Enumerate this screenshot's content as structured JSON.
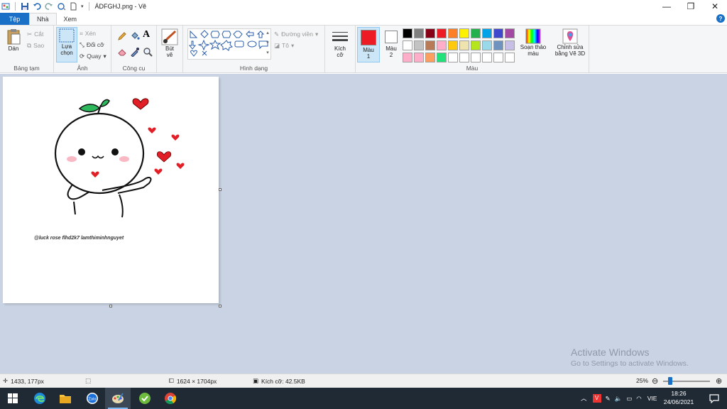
{
  "window": {
    "title": "ÁDFGHJ.png - Vẽ",
    "controls": {
      "minimize": "—",
      "restore": "❐",
      "close": "✕"
    }
  },
  "tabs": [
    {
      "label": "Tệp"
    },
    {
      "label": "Nhà"
    },
    {
      "label": "Xem"
    }
  ],
  "ribbon": {
    "clipboard": {
      "paste": "Dán",
      "cut": "Cắt",
      "copy": "Sao",
      "label": "Bảng tạm"
    },
    "image": {
      "select": "Lựa chọn",
      "crop": "Xén",
      "resize": "Đổi cỡ",
      "rotate": "Quay",
      "label": "Ảnh"
    },
    "tools": {
      "label": "Công cụ"
    },
    "brushes": {
      "label": "Bút vẽ"
    },
    "shapes": {
      "outline": "Đường viền",
      "fill": "Tô",
      "label": "Hình dạng"
    },
    "size": {
      "label": "Kích cỡ"
    },
    "colors": {
      "color1": "Màu 1",
      "color2": "Màu 2",
      "edit": "Soạn thảo màu",
      "label": "Màu",
      "color1_value": "#ed1c24",
      "color2_value": "#ffffff",
      "palette_row1": [
        "#000000",
        "#7f7f7f",
        "#880015",
        "#ed1c24",
        "#ff7f27",
        "#fff200",
        "#22b14c",
        "#00a2e8",
        "#3f48cc",
        "#a349a4"
      ],
      "palette_row2": [
        "#ffffff",
        "#c3c3c3",
        "#b97a57",
        "#ffaec9",
        "#ffc90e",
        "#efe4b0",
        "#b5e61d",
        "#99d9ea",
        "#7092be",
        "#c8bfe7"
      ],
      "palette_row3": [
        "#ffaec9",
        "#ffaec9",
        "#ff9f5f",
        "#22e07a",
        "#ffffff",
        "#ffffff",
        "#ffffff",
        "#ffffff",
        "#ffffff",
        "#ffffff"
      ]
    },
    "paint3d": {
      "label": "Chỉnh sửa bằng Vẽ 3D"
    }
  },
  "canvas": {
    "caption": "@luck rose flhd2k7 lamthiminhnguyet"
  },
  "watermark": {
    "title": "Activate Windows",
    "subtitle": "Go to Settings to activate Windows."
  },
  "status": {
    "cursor_pos": "1433, 177px",
    "image_size": "1624 × 1704px",
    "file_size": "Kích cỡ: 42.5KB",
    "zoom": "25%"
  },
  "taskbar": {
    "tray_lang": "VIE",
    "clock_time": "18:26",
    "clock_date": "24/06/2021"
  }
}
